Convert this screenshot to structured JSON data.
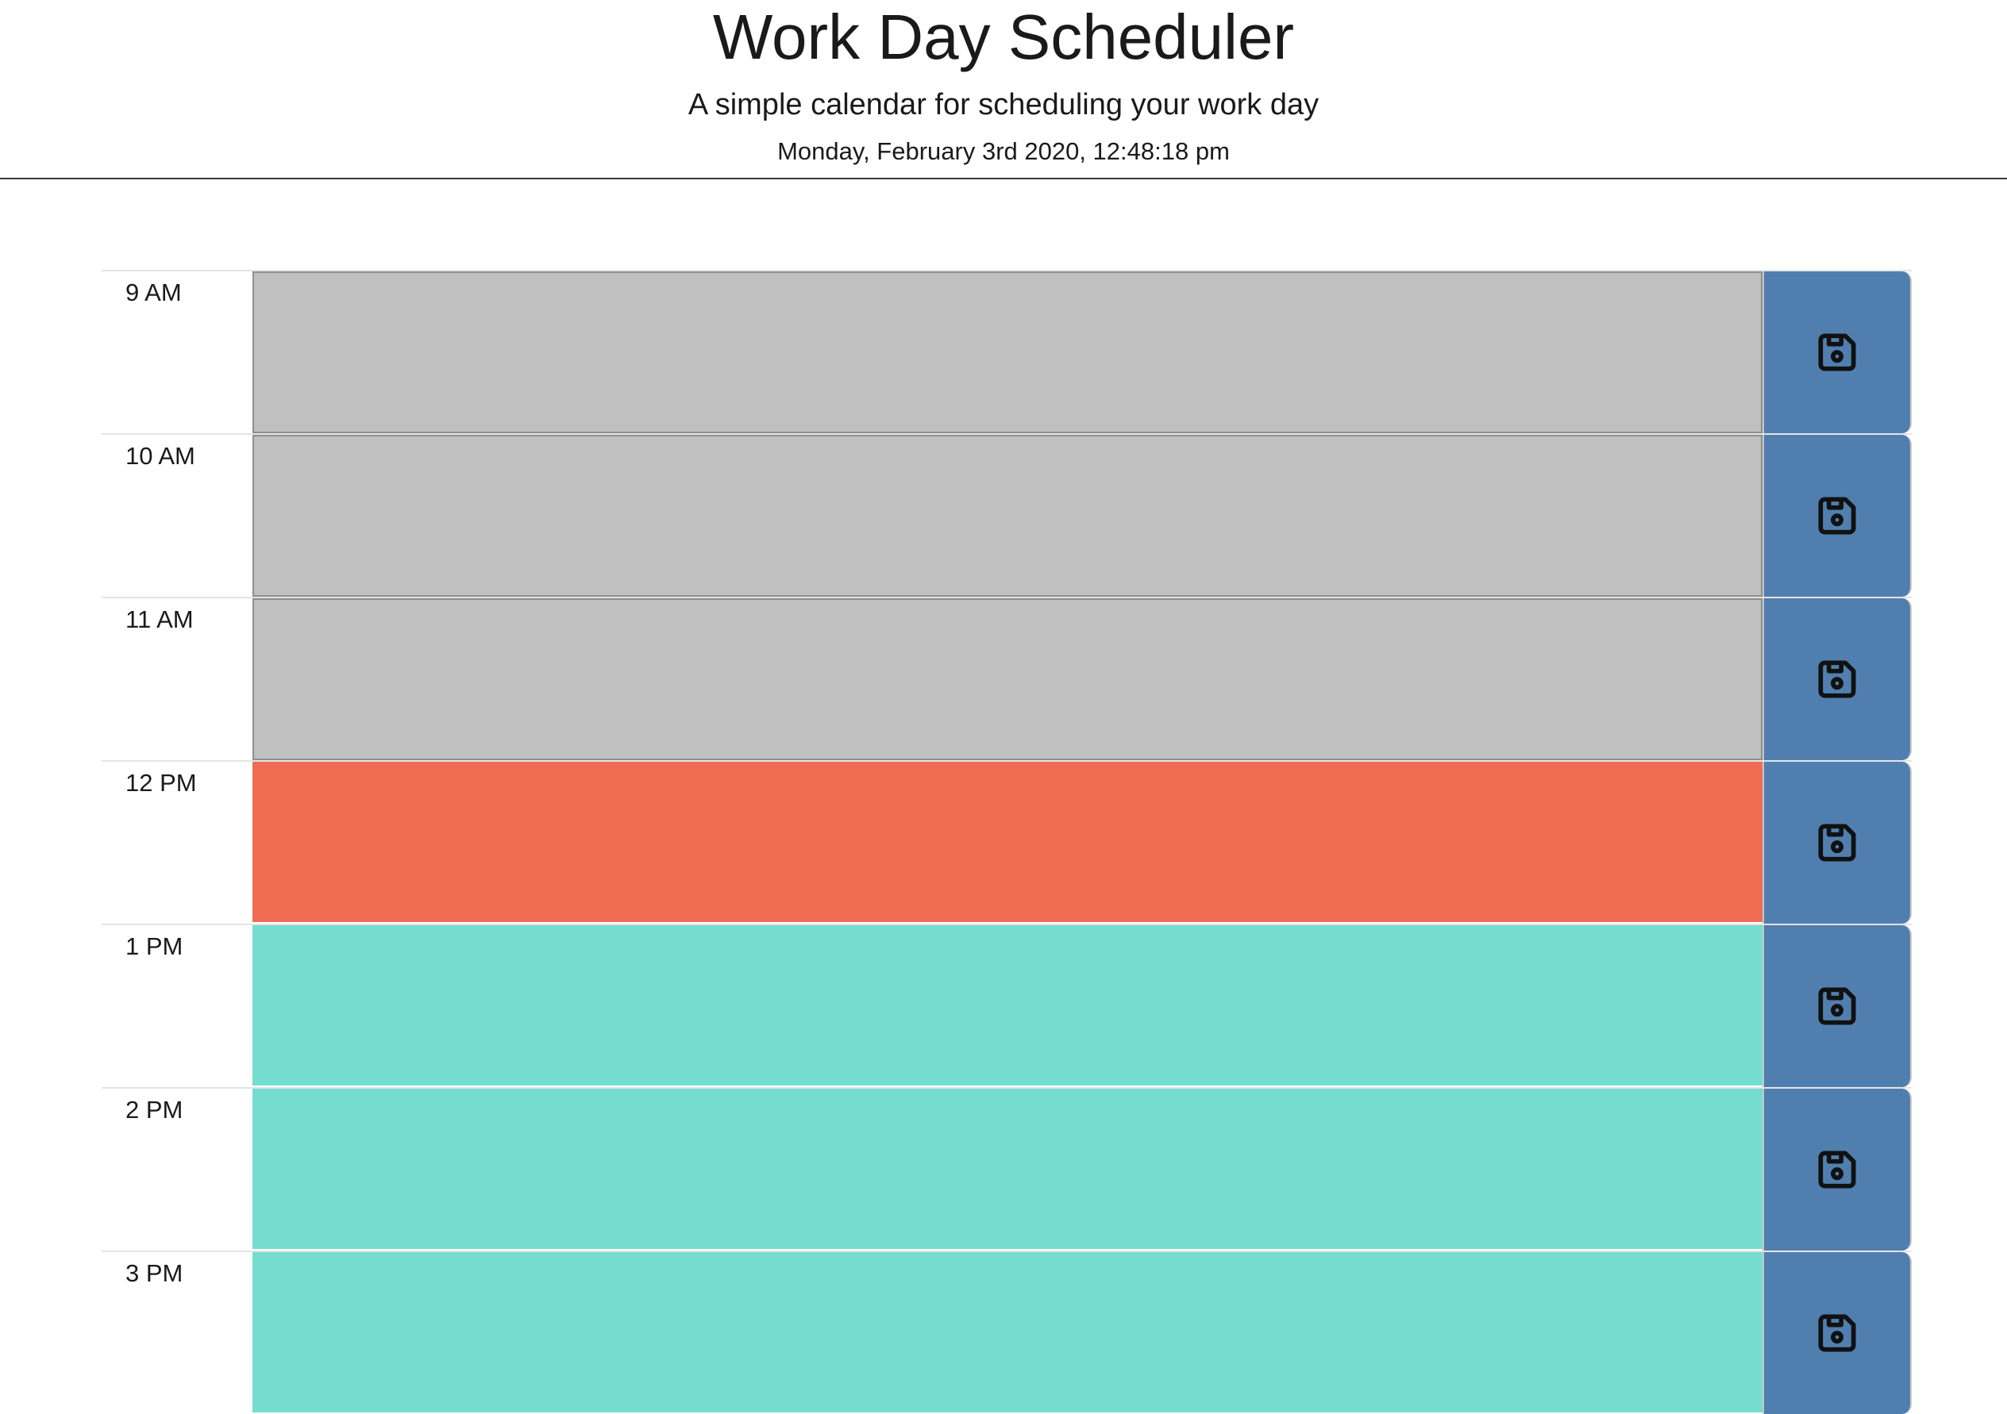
{
  "header": {
    "title": "Work Day Scheduler",
    "subtitle": "A simple calendar for scheduling your work day",
    "current_day": "Monday, February 3rd 2020, 12:48:18 pm"
  },
  "colors": {
    "past": "#c0c0c0",
    "present": "#ef6c53",
    "future": "#74ddd0",
    "save_button": "#507faf"
  },
  "save_icon": "floppy-disk-icon",
  "time_blocks": [
    {
      "hour": "9 AM",
      "state": "past",
      "text": ""
    },
    {
      "hour": "10 AM",
      "state": "past",
      "text": ""
    },
    {
      "hour": "11 AM",
      "state": "past",
      "text": ""
    },
    {
      "hour": "12 PM",
      "state": "present",
      "text": ""
    },
    {
      "hour": "1 PM",
      "state": "future",
      "text": ""
    },
    {
      "hour": "2 PM",
      "state": "future",
      "text": ""
    },
    {
      "hour": "3 PM",
      "state": "future",
      "text": ""
    }
  ]
}
